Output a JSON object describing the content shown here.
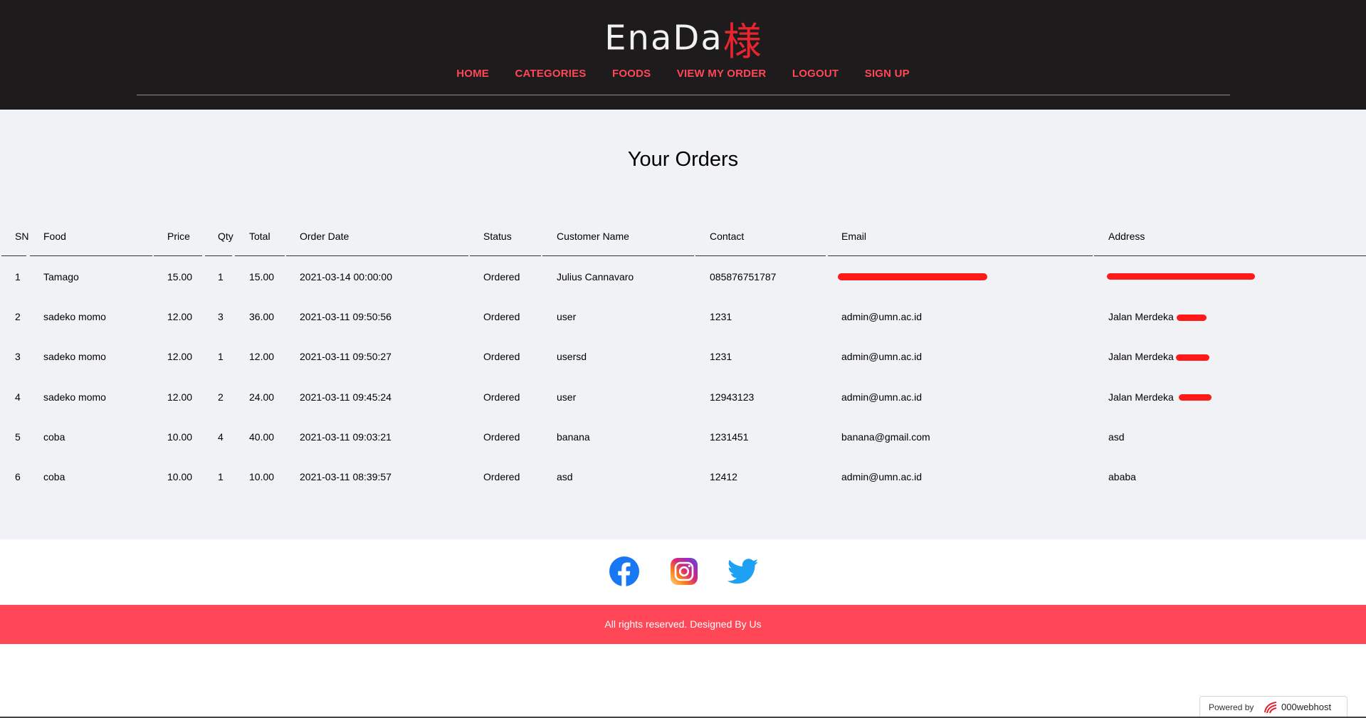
{
  "header": {
    "logo_latin": "EnaDa",
    "logo_kanji": "様",
    "nav": [
      "HOME",
      "CATEGORIES",
      "FOODS",
      "VIEW MY ORDER",
      "LOGOUT",
      "SIGN UP"
    ]
  },
  "colors": {
    "header_bg": "#1d1b1c",
    "accent": "#ff4757",
    "page_bg": "#f1f2f6",
    "redaction": "#ff1a1a"
  },
  "main": {
    "title": "Your Orders",
    "columns": [
      "SN",
      "Food",
      "Price",
      "Qty",
      "Total",
      "Order Date",
      "Status",
      "Customer Name",
      "Contact",
      "Email",
      "Address"
    ],
    "rows": [
      [
        "1",
        "Tamago",
        "15.00",
        "1",
        "15.00",
        "2021-03-14 00:00:00",
        "Ordered",
        "Julius Cannavaro",
        "085876751787",
        "",
        ""
      ],
      [
        "2",
        "sadeko momo",
        "12.00",
        "3",
        "36.00",
        "2021-03-11 09:50:56",
        "Ordered",
        "user",
        "1231",
        "admin@umn.ac.id",
        "Jalan Merdeka"
      ],
      [
        "3",
        "sadeko momo",
        "12.00",
        "1",
        "12.00",
        "2021-03-11 09:50:27",
        "Ordered",
        "usersd",
        "1231",
        "admin@umn.ac.id",
        "Jalan Merdeka"
      ],
      [
        "4",
        "sadeko momo",
        "12.00",
        "2",
        "24.00",
        "2021-03-11 09:45:24",
        "Ordered",
        "user",
        "12943123",
        "admin@umn.ac.id",
        "Jalan Merdeka"
      ],
      [
        "5",
        "coba",
        "10.00",
        "4",
        "40.00",
        "2021-03-11 09:03:21",
        "Ordered",
        "banana",
        "1231451",
        "banana@gmail.com",
        "asd"
      ],
      [
        "6",
        "coba",
        "10.00",
        "1",
        "10.00",
        "2021-03-11 08:39:57",
        "Ordered",
        "asd",
        "12412",
        "admin@umn.ac.id",
        "ababa"
      ]
    ]
  },
  "social": {
    "icons": [
      "facebook-icon",
      "instagram-icon",
      "twitter-icon"
    ]
  },
  "footer": {
    "text": "All rights reserved. Designed By Us"
  },
  "badge": {
    "powered_by": "Powered by",
    "brand": "000webhost"
  }
}
